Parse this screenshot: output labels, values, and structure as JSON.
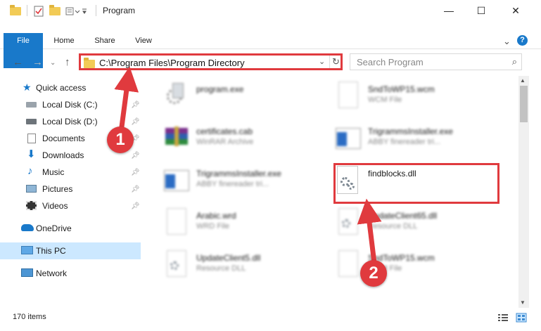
{
  "window": {
    "title": "Program",
    "minimize": "—",
    "maximize": "☐",
    "close": "✕"
  },
  "ribbon": {
    "tabs": [
      "File",
      "Home",
      "Share",
      "View"
    ],
    "help": "?"
  },
  "address": {
    "path": "C:\\Program Files\\Program Directory",
    "dropdown": "⌄",
    "refresh": "↻"
  },
  "search": {
    "placeholder": "Search Program"
  },
  "nav": {
    "quick_access": "Quick access",
    "items": [
      "Local Disk (C:)",
      "Local Disk (D:)",
      "Documents",
      "Downloads",
      "Music",
      "Pictures",
      "Videos"
    ],
    "onedrive": "OneDrive",
    "this_pc": "This PC",
    "network": "Network"
  },
  "files": [
    {
      "name": "program.exe",
      "type": ""
    },
    {
      "name": "SndToWP15.wcm",
      "type": "WCM File"
    },
    {
      "name": "certificates.cab",
      "type": "WinRAR Archive"
    },
    {
      "name": "TrigrammsInstaller.exe",
      "type": "ABBY finereader tri..."
    },
    {
      "name": "TrigrammsInstaller.exe",
      "type": "ABBY finereader tri..."
    },
    {
      "name": "findblocks.dll",
      "type": ""
    },
    {
      "name": "Arabic.wrd",
      "type": "WRD File"
    },
    {
      "name": "UpdateClient65.dll",
      "type": "Resource DLL"
    },
    {
      "name": "UpdateClient5.dll",
      "type": "Resource DLL"
    },
    {
      "name": "SndToWP15.wcm",
      "type": "WCM File"
    }
  ],
  "status": {
    "item_count": "170 items"
  },
  "annotations": {
    "step1": "1",
    "step2": "2"
  },
  "colors": {
    "accent": "#1979ca",
    "highlight": "#e03a3e",
    "selected": "#cce8ff"
  }
}
